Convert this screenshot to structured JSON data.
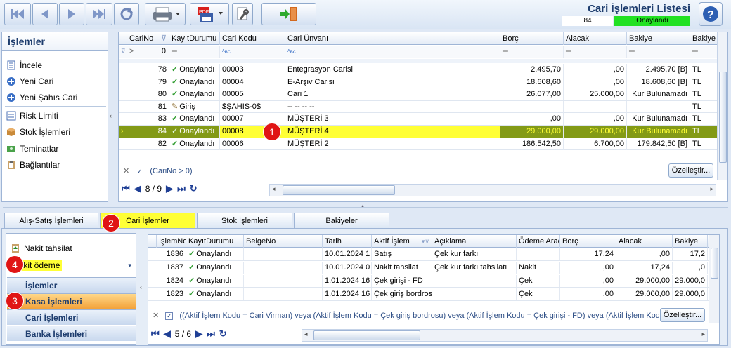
{
  "header": {
    "title": "Cari İşlemleri Listesi",
    "record_count": "84",
    "status": "Onaylandı"
  },
  "left_panel": {
    "title": "İşlemler",
    "items": [
      "İncele",
      "Yeni Cari",
      "Yeni Şahıs Cari",
      "Risk Limiti",
      "Stok İşlemleri",
      "Teminatlar",
      "Bağlantılar"
    ]
  },
  "top_grid": {
    "columns": [
      "CariNo",
      "KayıtDurumu",
      "Cari Kodu",
      "Cari Ünvanı",
      "Borç",
      "Alacak",
      "Bakiye",
      "Bakiye P"
    ],
    "filter_row": {
      "carino": "0"
    },
    "rows": [
      {
        "carino": "78",
        "durum": "Onaylandı",
        "kod": "00003",
        "unvan": "Entegrasyon Carisi",
        "borc": "2.495,70",
        "alacak": ",00",
        "bakiye": "2.495,70 [B]",
        "pb": "TL"
      },
      {
        "carino": "79",
        "durum": "Onaylandı",
        "kod": "00004",
        "unvan": "E-Arşiv Carisi",
        "borc": "18.608,60",
        "alacak": ",00",
        "bakiye": "18.608,60 [B]",
        "pb": "TL"
      },
      {
        "carino": "80",
        "durum": "Onaylandı",
        "kod": "00005",
        "unvan": "Cari 1",
        "borc": "26.077,00",
        "alacak": "25.000,00",
        "bakiye": "Kur Bulunamadı",
        "pb": "TL"
      },
      {
        "carino": "81",
        "durum": "Giriş",
        "kod": "$ŞAHIS-0$",
        "unvan": "-- -- -- --",
        "borc": "",
        "alacak": "",
        "bakiye": "",
        "pb": "TL"
      },
      {
        "carino": "83",
        "durum": "Onaylandı",
        "kod": "00007",
        "unvan": "MÜŞTERİ 3",
        "borc": ",00",
        "alacak": ",00",
        "bakiye": "Kur Bulunamadı",
        "pb": "TL"
      },
      {
        "carino": "84",
        "durum": "Onaylandı",
        "kod": "00008",
        "unvan": "MÜŞTERİ 4",
        "borc": "29.000,00",
        "alacak": "29.000,00",
        "bakiye": "Kur Bulunamadı",
        "pb": "TL"
      },
      {
        "carino": "82",
        "durum": "Onaylandı",
        "kod": "00006",
        "unvan": "MÜŞTERİ 2",
        "borc": "186.542,50",
        "alacak": "6.700,00",
        "bakiye": "179.842,50 [B]",
        "pb": "TL"
      }
    ],
    "filter_text": "(CariNo > 0)",
    "customize_label": "Özelleştir...",
    "page": "8 / 9"
  },
  "tabs": [
    "Alış-Satış İşlemleri",
    "Cari İşlemler",
    "Stok İşlemleri",
    "Bakiyeler"
  ],
  "lower_panel": {
    "items": [
      "Nakit tahsilat",
      "Nakit ödeme"
    ],
    "nav": [
      "İşlemler",
      "Kasa İşlemleri",
      "Cari İşlemleri",
      "Banka İşlemleri"
    ]
  },
  "bottom_grid": {
    "columns": [
      "İşlemNo",
      "KayıtDurumu",
      "BelgeNo",
      "Tarih",
      "Aktif İşlem",
      "Açıklama",
      "Ödeme Aracı",
      "Borç",
      "Alacak",
      "Bakiye"
    ],
    "rows": [
      {
        "no": "1836",
        "durum": "Onaylandı",
        "belge": "",
        "tarih": "10.01.2024 1",
        "islem": "Satış",
        "aciklama": "Çek kur farkı",
        "arac": "",
        "borc": "17,24",
        "alacak": ",00",
        "bakiye": "17,2"
      },
      {
        "no": "1837",
        "durum": "Onaylandı",
        "belge": "",
        "tarih": "10.01.2024 0",
        "islem": "Nakit tahsilat",
        "aciklama": "Çek kur farkı tahsilatı",
        "arac": "Nakit",
        "borc": ",00",
        "alacak": "17,24",
        "bakiye": ",0"
      },
      {
        "no": "1824",
        "durum": "Onaylandı",
        "belge": "",
        "tarih": "1.01.2024 16",
        "islem": "Çek girişi - FD",
        "aciklama": "",
        "arac": "Çek",
        "borc": ",00",
        "alacak": "29.000,00",
        "bakiye": "29.000,0"
      },
      {
        "no": "1823",
        "durum": "Onaylandı",
        "belge": "",
        "tarih": "1.01.2024 16",
        "islem": "Çek giriş bordros",
        "aciklama": "",
        "arac": "Çek",
        "borc": ",00",
        "alacak": "29.000,00",
        "bakiye": "29.000,0"
      }
    ],
    "filter_text": "((Aktif İşlem Kodu = Cari Virman) veya (Aktif İşlem Kodu = Çek giriş bordrosu) veya (Aktif İşlem Kodu = Çek girişi - FD) veya (Aktif İşlem Kodu",
    "customize_label": "Özelleştir...",
    "page": "5 / 6"
  },
  "badges": [
    "1",
    "2",
    "3",
    "4"
  ],
  "colors": {
    "selected_row": "#839a16",
    "highlight": "#ffff35",
    "status_green": "#22e122",
    "badge_red": "#e01515"
  }
}
